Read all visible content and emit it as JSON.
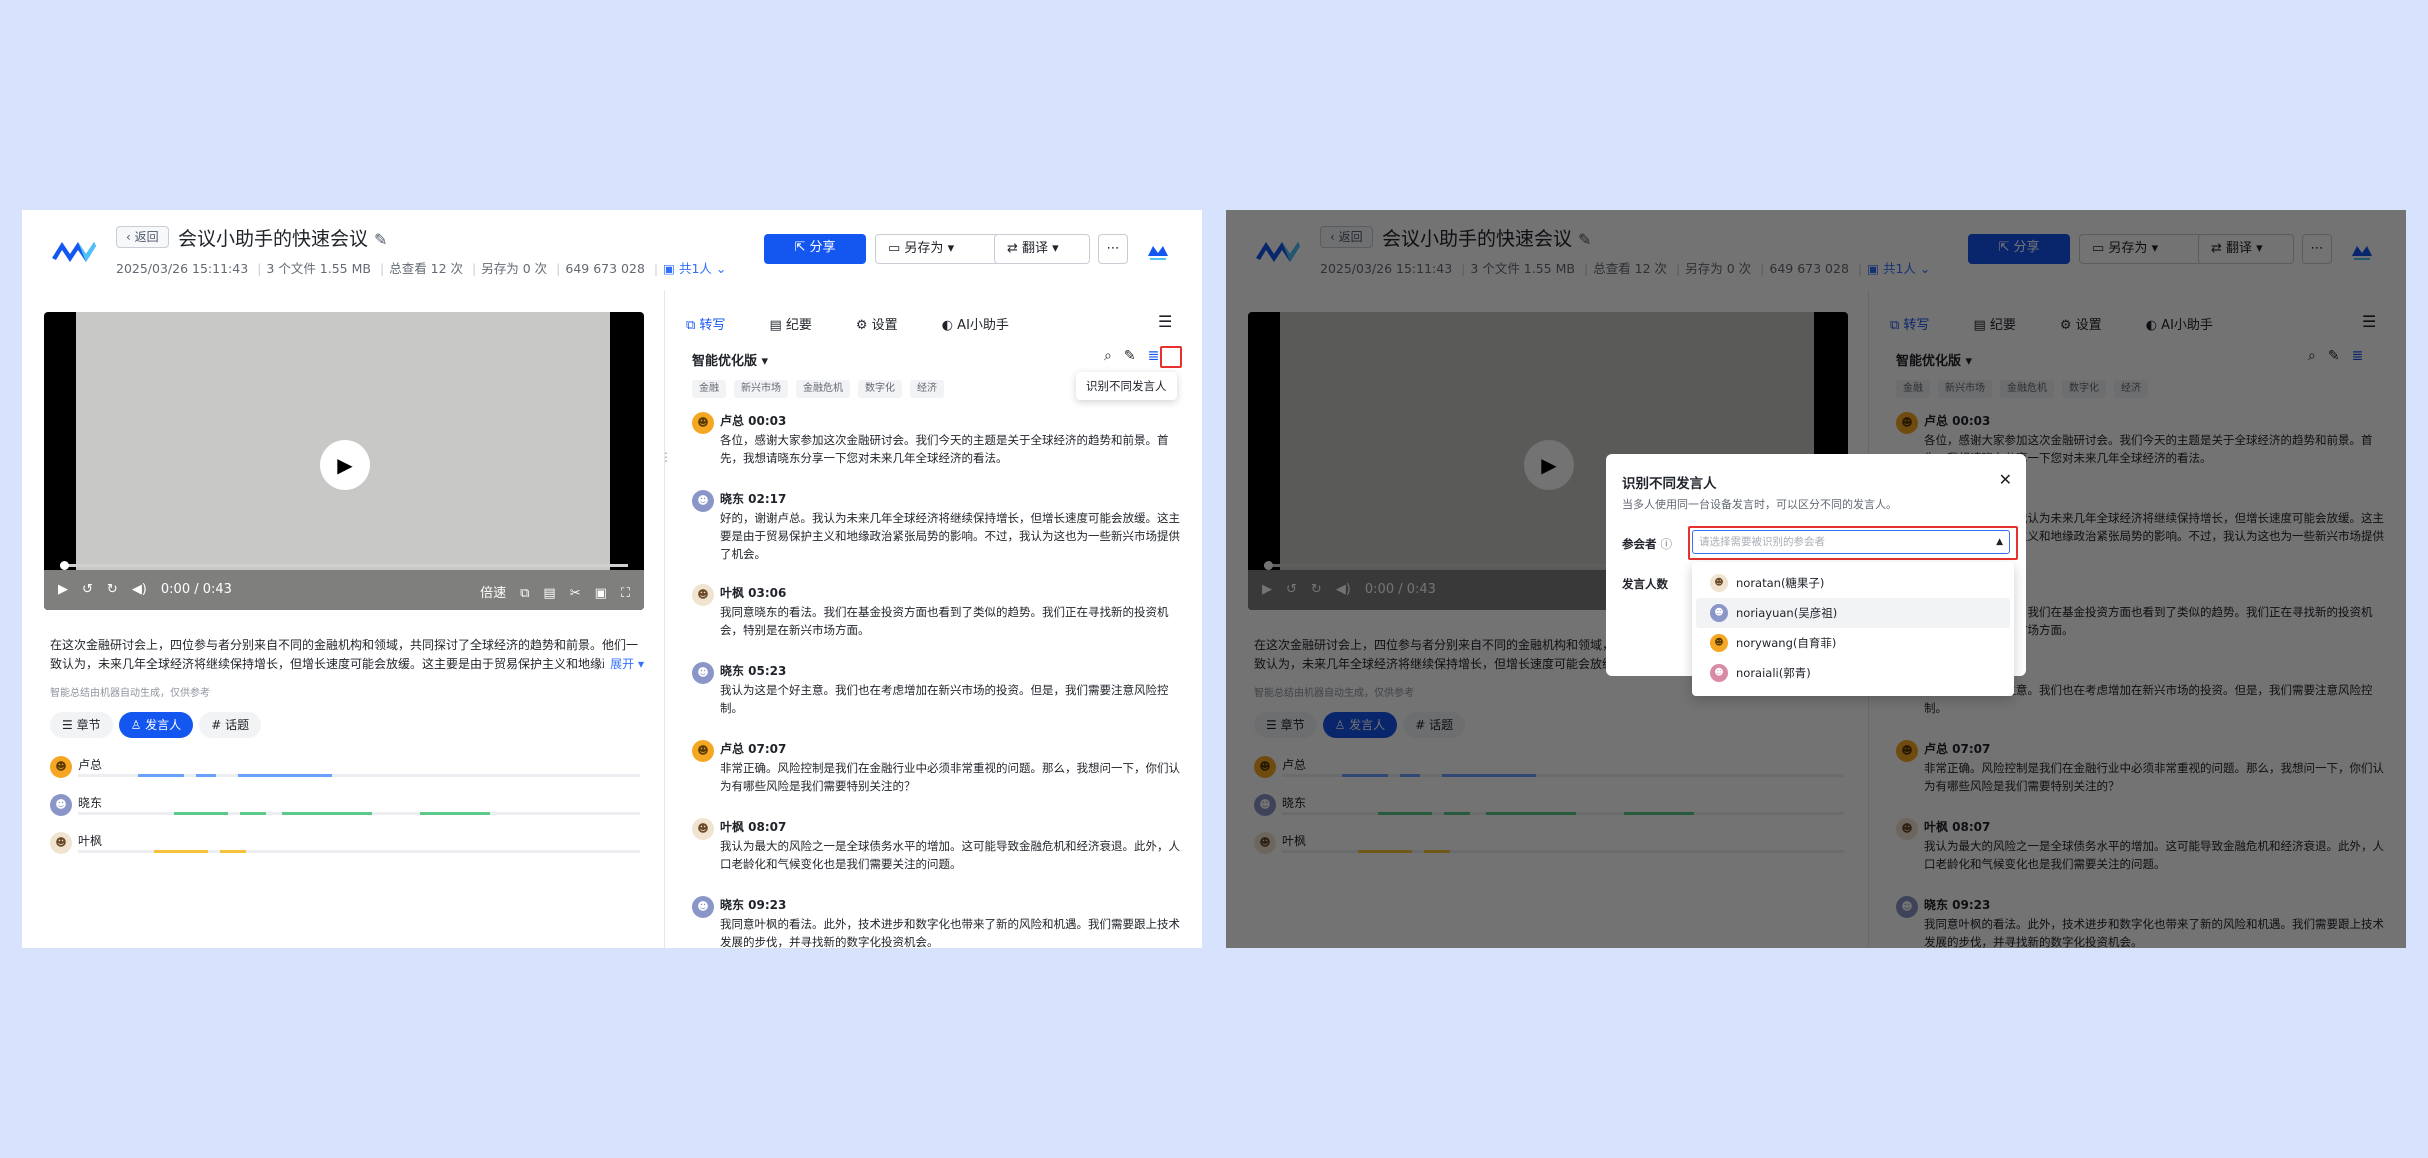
{
  "meeting": {
    "back": "返回",
    "title": "会议小助手的快速会议",
    "date": "2025/03/26 15:11:43",
    "files": "3 个文件 1.55 MB",
    "views": "总查看 12 次",
    "saves": "另存为 0 次",
    "id": "649 673 028",
    "people": "共1人"
  },
  "toolbar": {
    "share": "分享",
    "save_as": "另存为",
    "translate": "翻译",
    "more": "⋯"
  },
  "video": {
    "time": "0:00 / 0:43",
    "speed": "倍速"
  },
  "summary": {
    "text": "在这次金融研讨会上，四位参与者分别来自不同的金融机构和领域，共同探讨了全球经济的趋势和前景。他们一致认为，未来几年全球经济将继续保持增长，但增长速度可能会放缓。这主要是由于贸易保护主义和地缘政治",
    "expand": "展开",
    "ai_note": "智能总结由机器自动生成，仅供参考"
  },
  "left_tabs": [
    "章节",
    "发言人",
    "话题"
  ],
  "speakers": [
    {
      "name": "卢总",
      "color": "#6aa1ff"
    },
    {
      "name": "晓东",
      "color": "#5ac98a"
    },
    {
      "name": "叶枫",
      "color": "#f5c33b"
    }
  ],
  "right_tabs": [
    "转写",
    "纪要",
    "设置",
    "AI小助手"
  ],
  "transcript": {
    "version": "智能优化版",
    "tags": [
      "金融",
      "新兴市场",
      "金融危机",
      "数字化",
      "经济"
    ],
    "tooltip": "识别不同发言人",
    "entries": [
      {
        "who": "卢总 00:03",
        "text": "各位，感谢大家参加这次金融研讨会。我们今天的主题是关于全球经济的趋势和前景。首先，我想请晓东分享一下您对未来几年全球经济的看法。"
      },
      {
        "who": "晓东 02:17",
        "text": "好的，谢谢卢总。我认为未来几年全球经济将继续保持增长，但增长速度可能会放缓。这主要是由于贸易保护主义和地缘政治紧张局势的影响。不过，我认为这也为一些新兴市场提供了机会。"
      },
      {
        "who": "叶枫 03:06",
        "text": "我同意晓东的看法。我们在基金投资方面也看到了类似的趋势。我们正在寻找新的投资机会，特别是在新兴市场方面。"
      },
      {
        "who": "晓东 05:23",
        "text": "我认为这是个好主意。我们也在考虑增加在新兴市场的投资。但是，我们需要注意风险控制。"
      },
      {
        "who": "卢总 07:07",
        "text": "非常正确。风险控制是我们在金融行业中必须非常重视的问题。那么，我想问一下，你们认为有哪些风险是我们需要特别关注的？"
      },
      {
        "who": "叶枫 08:07",
        "text": "我认为最大的风险之一是全球债务水平的增加。这可能导致金融危机和经济衰退。此外，人口老龄化和气候变化也是我们需要关注的问题。"
      },
      {
        "who": "晓东 09:23",
        "text": "我同意叶枫的看法。此外，技术进步和数字化也带来了新的风险和机遇。我们需要跟上技术发展的步伐，并寻找新的数字化投资机会。"
      }
    ]
  },
  "dialog": {
    "title": "识别不同发言人",
    "desc": "当多人使用同一台设备发言时，可以区分不同的发言人。",
    "participants_label": "参会者",
    "placeholder": "请选择需要被识别的参会者",
    "count_label": "发言人数",
    "options": [
      "noratan(糖果子)",
      "noriayuan(吴彦祖)",
      "norywang(自育菲)",
      "noraiali(郭青)"
    ]
  },
  "colors": {
    "accent": "#1456f0",
    "highlight": "#e5322d"
  }
}
